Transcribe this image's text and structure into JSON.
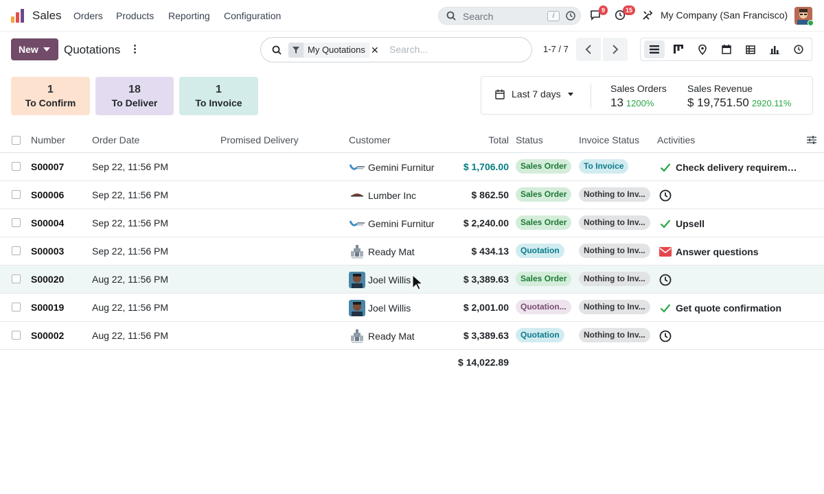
{
  "app": {
    "name": "Sales"
  },
  "menu": [
    "Orders",
    "Products",
    "Reporting",
    "Configuration"
  ],
  "nav_search": {
    "placeholder": "Search",
    "shortcut": "/"
  },
  "notifications": {
    "messages": "9",
    "activities": "15"
  },
  "company": "My Company (San Francisco)",
  "control": {
    "new_label": "New",
    "breadcrumb": "Quotations",
    "facet": "My Quotations",
    "search_placeholder": "Search...",
    "pager": "1-7 / 7"
  },
  "cards": [
    {
      "count": "1",
      "label": "To Confirm",
      "color": "#fde2cf"
    },
    {
      "count": "18",
      "label": "To Deliver",
      "color": "#e3dcf1"
    },
    {
      "count": "1",
      "label": "To Invoice",
      "color": "#d3ecea"
    }
  ],
  "stats": {
    "date_filter": "Last 7 days",
    "sales_orders": {
      "title": "Sales Orders",
      "value": "13",
      "pct": "1200%"
    },
    "sales_revenue": {
      "title": "Sales Revenue",
      "value": "$ 19,751.50",
      "pct": "2920.11%"
    }
  },
  "columns": [
    "Number",
    "Order Date",
    "Promised Delivery",
    "Customer",
    "Total",
    "Status",
    "Invoice Status",
    "Activities"
  ],
  "rows": [
    {
      "number": "S00007",
      "date": "Sep 22, 11:56 PM",
      "customer": "Gemini Furnitur",
      "customer_icon": "gemini-logo",
      "total": "$ 1,706.00",
      "total_highlight": true,
      "status": "Sales Order",
      "status_color": "green",
      "invoice": "To Invoice",
      "invoice_color": "teal",
      "activity_icon": "check-icon",
      "activity": "Check delivery requiremen..."
    },
    {
      "number": "S00006",
      "date": "Sep 22, 11:56 PM",
      "customer": "Lumber Inc",
      "customer_icon": "lumber-logo",
      "total": "$ 862.50",
      "total_highlight": false,
      "status": "Sales Order",
      "status_color": "green",
      "invoice": "Nothing to Inv...",
      "invoice_color": "grey",
      "activity_icon": "clock-icon",
      "activity": ""
    },
    {
      "number": "S00004",
      "date": "Sep 22, 11:56 PM",
      "customer": "Gemini Furnitur",
      "customer_icon": "gemini-logo",
      "total": "$ 2,240.00",
      "total_highlight": false,
      "status": "Sales Order",
      "status_color": "green",
      "invoice": "Nothing to Inv...",
      "invoice_color": "grey",
      "activity_icon": "check-icon",
      "activity": "Upsell"
    },
    {
      "number": "S00003",
      "date": "Sep 22, 11:56 PM",
      "customer": "Ready Mat",
      "customer_icon": "readymat-logo",
      "total": "$ 434.13",
      "total_highlight": false,
      "status": "Quotation",
      "status_color": "teal",
      "invoice": "Nothing to Inv...",
      "invoice_color": "grey",
      "activity_icon": "envelope-icon",
      "activity": "Answer questions"
    },
    {
      "number": "S00020",
      "date": "Aug 22, 11:56 PM",
      "customer": "Joel Willis",
      "customer_icon": "person-avatar",
      "total": "$ 3,389.63",
      "total_highlight": false,
      "status": "Sales Order",
      "status_color": "green",
      "invoice": "Nothing to Inv...",
      "invoice_color": "grey",
      "activity_icon": "clock-icon",
      "activity": ""
    },
    {
      "number": "S00019",
      "date": "Aug 22, 11:56 PM",
      "customer": "Joel Willis",
      "customer_icon": "person-avatar",
      "total": "$ 2,001.00",
      "total_highlight": false,
      "status": "Quotation...",
      "status_color": "purple",
      "invoice": "Nothing to Inv...",
      "invoice_color": "grey",
      "activity_icon": "check-icon",
      "activity": "Get quote confirmation"
    },
    {
      "number": "S00002",
      "date": "Aug 22, 11:56 PM",
      "customer": "Ready Mat",
      "customer_icon": "readymat-logo",
      "total": "$ 3,389.63",
      "total_highlight": false,
      "status": "Quotation",
      "status_color": "teal",
      "invoice": "Nothing to Inv...",
      "invoice_color": "grey",
      "activity_icon": "clock-icon",
      "activity": ""
    }
  ],
  "grand_total": "$ 14,022.89",
  "colors": {
    "brand": "#714b67",
    "accent": "#017e84",
    "positive": "#28a745"
  }
}
